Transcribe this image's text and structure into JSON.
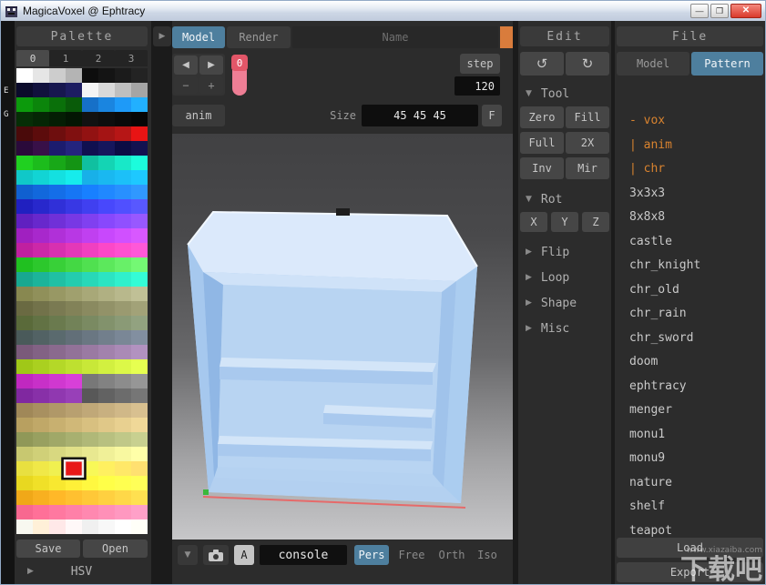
{
  "window": {
    "title": "MagicaVoxel @ Ephtracy",
    "controls": {
      "minimize": "—",
      "maximize": "❐",
      "close": "✕"
    }
  },
  "icons": {
    "expand": "▶",
    "collapse": "▼",
    "left_arrow": "◀",
    "right_arrow": "▶",
    "minus": "−",
    "plus": "+",
    "undo": "↺",
    "redo": "↻",
    "dropdown": "▼"
  },
  "palette": {
    "header": "Palette",
    "tabs": [
      "0",
      "1",
      "2",
      "3"
    ],
    "active_tab": "0",
    "edge_labels": [
      "E",
      "G"
    ],
    "save_label": "Save",
    "open_label": "Open",
    "hsv_label": "HSV",
    "selected_index": 219,
    "colors": [
      [
        "#ffffff",
        "#e6e6e6",
        "#cdcdcd",
        "#b4b4b4",
        "#0d0d0d",
        "#141414",
        "#1b1b1b",
        "#232323"
      ],
      [
        "#0b0b2b",
        "#11113d",
        "#17174f",
        "#1d1d61",
        "#f4f4f4",
        "#d9d9d9",
        "#bfbfbf",
        "#a5a5a5"
      ],
      [
        "#0c9a0c",
        "#0b850b",
        "#0a700a",
        "#095b09",
        "#1670c8",
        "#1a85e0",
        "#1e9af8",
        "#22b0ff"
      ],
      [
        "#062e06",
        "#052605",
        "#041e04",
        "#031603",
        "#121212",
        "#0e0e0e",
        "#0a0a0a",
        "#060606"
      ],
      [
        "#4a0a0a",
        "#5c0c0c",
        "#6e0e0e",
        "#801010",
        "#921212",
        "#a41414",
        "#b61616",
        "#e81414"
      ],
      [
        "#2a0a3a",
        "#381048",
        "#1c1c6e",
        "#24247e",
        "#101050",
        "#16165c",
        "#0c0c44",
        "#121250"
      ],
      [
        "#20d020",
        "#1cbc1c",
        "#18a818",
        "#149414",
        "#10c0a0",
        "#14d4b4",
        "#18e8c8",
        "#1cfcdc"
      ],
      [
        "#10c8c8",
        "#12d4d4",
        "#14e0e0",
        "#16ecec",
        "#18b0e8",
        "#1ab8f0",
        "#1cc0f8",
        "#1ec8ff"
      ],
      [
        "#1060d0",
        "#1268dc",
        "#146ee8",
        "#1676f4",
        "#1880ff",
        "#2088ff",
        "#2890ff",
        "#3098ff"
      ],
      [
        "#2020c0",
        "#2828cc",
        "#3030d8",
        "#3838e4",
        "#4040f0",
        "#4848fc",
        "#5050ff",
        "#5858ff"
      ],
      [
        "#6020c0",
        "#6828cc",
        "#7030d8",
        "#7838e4",
        "#8040f0",
        "#8848fc",
        "#9050ff",
        "#9858ff"
      ],
      [
        "#a020c0",
        "#a828cc",
        "#b030d8",
        "#b838e4",
        "#c040f0",
        "#c848fc",
        "#d050ff",
        "#d858ff"
      ],
      [
        "#c020a0",
        "#cc28a8",
        "#d830b0",
        "#e438b8",
        "#f040c0",
        "#fc48c8",
        "#ff50d0",
        "#ff58d8"
      ],
      [
        "#20c020",
        "#2cc82c",
        "#38d038",
        "#44d844",
        "#50e050",
        "#5ce85c",
        "#68f068",
        "#74f874"
      ],
      [
        "#18a890",
        "#1cb49a",
        "#20c0a4",
        "#24ccae",
        "#28d8b8",
        "#2ce4c2",
        "#30f0cc",
        "#34fcd6"
      ],
      [
        "#888850",
        "#90905a",
        "#989864",
        "#a0a06e",
        "#a8a878",
        "#b0b082",
        "#b8b88c",
        "#c0c096"
      ],
      [
        "#6a6a42",
        "#72724a",
        "#7a7a52",
        "#828258",
        "#8a8a60",
        "#929268",
        "#9a9a70",
        "#a2a278"
      ],
      [
        "#5a6a3a",
        "#627244",
        "#6a7a4e",
        "#728258",
        "#7a8a62",
        "#82926c",
        "#8a9a76",
        "#92a280"
      ],
      [
        "#4a5a5a",
        "#526264",
        "#5a6a6e",
        "#626f78",
        "#6a7782",
        "#727f8c",
        "#7a8796",
        "#828fa0"
      ],
      [
        "#7a5a7a",
        "#826284",
        "#8a6a8e",
        "#927298",
        "#9a7aa2",
        "#a282ac",
        "#aa8ab6",
        "#b292c0"
      ],
      [
        "#a0c818",
        "#aad020",
        "#b4d828",
        "#bee030",
        "#c8e838",
        "#d2f040",
        "#dcf848",
        "#e6ff50"
      ],
      [
        "#c028c0",
        "#c830c8",
        "#d038d0",
        "#d840d8",
        "#787878",
        "#828282",
        "#8c8c8c",
        "#969696"
      ],
      [
        "#8028a0",
        "#8830a8",
        "#9038b0",
        "#9840b8",
        "#585858",
        "#626262",
        "#6c6c6c",
        "#767676"
      ],
      [
        "#a08858",
        "#a89060",
        "#b09868",
        "#b8a070",
        "#c0a878",
        "#c8b080",
        "#d0b888",
        "#d8c090"
      ],
      [
        "#b8a060",
        "#c0a868",
        "#c8b070",
        "#d0b878",
        "#d8c080",
        "#e0c888",
        "#e8d090",
        "#f0d898"
      ],
      [
        "#909858",
        "#98a060",
        "#a0a868",
        "#a8b070",
        "#b0b878",
        "#b8c080",
        "#c0c888",
        "#c8d090"
      ],
      [
        "#c8c870",
        "#d0d078",
        "#d8d880",
        "#e0e088",
        "#e8e890",
        "#f0f098",
        "#f8f8a0",
        "#ffffa8"
      ],
      [
        "#e8e040",
        "#f0e848",
        "#f0f050",
        "#e81818",
        "#f8f858",
        "#fff060",
        "#ffe868",
        "#ffe070"
      ],
      [
        "#e8d820",
        "#f0e028",
        "#f8e830",
        "#fff038",
        "#fff840",
        "#ffff48",
        "#ffff50",
        "#ffff58"
      ],
      [
        "#f0a818",
        "#f8b020",
        "#ffb828",
        "#ffc030",
        "#ffc838",
        "#ffd040",
        "#ffd848",
        "#ffe050"
      ],
      [
        "#f86890",
        "#ff7098",
        "#ff78a0",
        "#ff80a8",
        "#ff88b0",
        "#ff90b8",
        "#ff98c0",
        "#ffa0c8"
      ],
      [
        "#f8f8f0",
        "#fff0d8",
        "#ffe8e8",
        "#fff8f8",
        "#f0f0f0",
        "#f8f8f8",
        "#ffffff",
        "#fffff8"
      ]
    ]
  },
  "model_bar": {
    "model_tab": "Model",
    "render_tab": "Render",
    "name_placeholder": "Name",
    "frame_value": "0",
    "step_label": "step",
    "step_value": "120",
    "anim_label": "anim",
    "size_label": "Size",
    "size_value": "45 45 45",
    "f_label": "F",
    "accent_color": "#d97c3c",
    "slider_color": "#ee7e95"
  },
  "viewport_bar": {
    "a_label": "A",
    "console_label": "console",
    "views": [
      "Pers",
      "Free",
      "Orth",
      "Iso"
    ],
    "active_view": "Pers"
  },
  "edit_panel": {
    "header": "Edit",
    "tool_section": {
      "label": "Tool",
      "buttons": [
        "Zero",
        "Fill",
        "Full",
        "2X",
        "Inv",
        "Mir"
      ]
    },
    "rot_section": {
      "label": "Rot",
      "buttons": [
        "X",
        "Y",
        "Z"
      ]
    },
    "collapsed_sections": [
      "Flip",
      "Loop",
      "Shape",
      "Misc"
    ]
  },
  "file_panel": {
    "header": "File",
    "model_tab": "Model",
    "pattern_tab": "Pattern",
    "active_tab": "Pattern",
    "accent_color": "#d9832f",
    "items": [
      {
        "label": "- vox"
      },
      {
        "label": "| anim"
      },
      {
        "label": "| chr"
      },
      {
        "label": "3x3x3"
      },
      {
        "label": "8x8x8"
      },
      {
        "label": "castle"
      },
      {
        "label": "chr_knight"
      },
      {
        "label": "chr_old"
      },
      {
        "label": "chr_rain"
      },
      {
        "label": "chr_sword"
      },
      {
        "label": "doom"
      },
      {
        "label": "ephtracy"
      },
      {
        "label": "menger"
      },
      {
        "label": "monu1"
      },
      {
        "label": "monu9"
      },
      {
        "label": "nature"
      },
      {
        "label": "shelf"
      },
      {
        "label": "teapot"
      }
    ],
    "load_label": "Load",
    "export_label": "Export"
  },
  "watermark": {
    "text": "下载吧",
    "sub": "www.xiazaiba.com"
  }
}
